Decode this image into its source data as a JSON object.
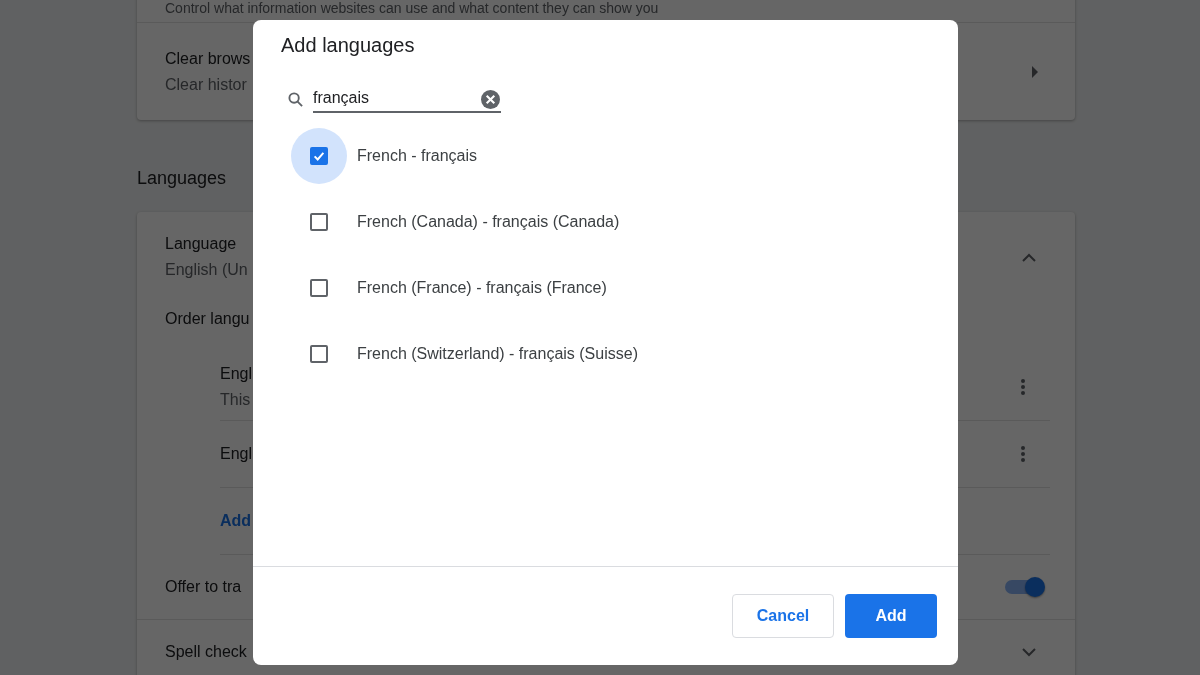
{
  "page": {
    "privacy_card": {
      "rows": [
        {
          "title": "Control what information websites can use and what content they can show you"
        },
        {
          "title": "Clear brows",
          "subtitle": "Clear histor"
        }
      ]
    },
    "languages_heading": "Languages",
    "languages_card": {
      "language": {
        "title": "Language",
        "subtitle": "English (Un",
        "expanded": true
      },
      "order_label": "Order langu",
      "order_items": [
        {
          "title": "Engl",
          "subtitle": "This"
        },
        {
          "title": "Engl"
        }
      ],
      "add_link": "Add",
      "offer_translate": {
        "label": "Offer to tra",
        "on": true
      },
      "spell_check": {
        "label": "Spell check",
        "expanded": false
      }
    }
  },
  "dialog": {
    "title": "Add languages",
    "search": {
      "value": "français"
    },
    "options": [
      {
        "label": "French - français",
        "checked": true,
        "focused": true
      },
      {
        "label": "French (Canada) - français (Canada)",
        "checked": false,
        "focused": false
      },
      {
        "label": "French (France) - français (France)",
        "checked": false,
        "focused": false
      },
      {
        "label": "French (Switzerland) - français (Suisse)",
        "checked": false,
        "focused": false
      }
    ],
    "buttons": [
      {
        "label": "Cancel",
        "kind": "secondary"
      },
      {
        "label": "Add",
        "kind": "primary"
      }
    ]
  }
}
